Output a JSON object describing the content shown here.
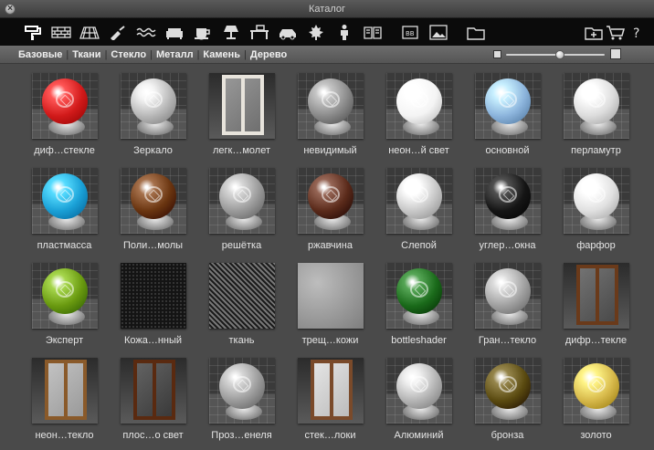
{
  "window": {
    "title": "Каталог"
  },
  "toolbar": {
    "icons": [
      "paint-icon",
      "brick-icon",
      "tiles-icon",
      "trowel-icon",
      "water-icon",
      "sofa-icon",
      "cup-icon",
      "lamp-icon",
      "desk-icon",
      "car-icon",
      "leaf-icon",
      "person-icon",
      "book-icon",
      "bsdf-icon",
      "image-icon",
      "folder-icon"
    ],
    "right_icons": [
      "new-folder-icon",
      "cart-icon",
      "help-icon"
    ]
  },
  "categories": [
    "Базовые",
    "Ткани",
    "Стекло",
    "Металл",
    "Камень",
    "Дерево"
  ],
  "zoom": {
    "value": 0.55
  },
  "materials": [
    [
      {
        "label": "диф…стекле",
        "kind": "sphere",
        "color": "#d11a1a"
      },
      {
        "label": "Зеркало",
        "kind": "sphere",
        "color": "#b8b8b8"
      },
      {
        "label": "легк…молет",
        "kind": "window",
        "frame": "#e8e4dc",
        "glass": "#6f6f6f"
      },
      {
        "label": "невидимый",
        "kind": "sphere",
        "color": "#8a8a8a"
      },
      {
        "label": "неон…й свет",
        "kind": "sphere",
        "color": "#f4f4f4"
      },
      {
        "label": "основной",
        "kind": "sphere",
        "color": "#8cb4dc"
      },
      {
        "label": "перламутр",
        "kind": "sphere",
        "color": "#dcdcdc"
      }
    ],
    [
      {
        "label": "пластмасса",
        "kind": "sphere",
        "color": "#1aa0d6"
      },
      {
        "label": "Поли…молы",
        "kind": "sphere",
        "color": "#6a3510"
      },
      {
        "label": "решётка",
        "kind": "sphere",
        "color": "#9a9a9a"
      },
      {
        "label": "ржавчина",
        "kind": "sphere",
        "color": "#5a2a1a"
      },
      {
        "label": "Слепой",
        "kind": "sphere",
        "color": "#c8c8c8"
      },
      {
        "label": "углер…окна",
        "kind": "sphere",
        "color": "#151515"
      },
      {
        "label": "фарфор",
        "kind": "sphere",
        "color": "#e0e0e0"
      }
    ],
    [
      {
        "label": "Эксперт",
        "kind": "sphere",
        "color": "#6a9a10"
      },
      {
        "label": "Кожа…нный",
        "kind": "texture",
        "texture": "leather"
      },
      {
        "label": "ткань",
        "kind": "texture",
        "texture": "fabric"
      },
      {
        "label": "трещ…кожи",
        "kind": "texture",
        "texture": "crackle"
      },
      {
        "label": "bottleshader",
        "kind": "sphere",
        "color": "#1a6a1a"
      },
      {
        "label": "Гран…текло",
        "kind": "sphere",
        "color": "#a0a0a0"
      },
      {
        "label": "дифр…текле",
        "kind": "window",
        "frame": "#6a3a1a",
        "glass": "#4a4a4a"
      }
    ],
    [
      {
        "label": "неон…текло",
        "kind": "window",
        "frame": "#8a5a2a",
        "glass": "#9a9a9a"
      },
      {
        "label": "плос…о свет",
        "kind": "window",
        "frame": "#5a2a10",
        "glass": "#3a3a3a"
      },
      {
        "label": "Проз…енеля",
        "kind": "sphere",
        "color": "#9a9a9a"
      },
      {
        "label": "стек…локи",
        "kind": "window",
        "frame": "#7a4a2a",
        "glass": "#bcbcbc"
      },
      {
        "label": "Алюминий",
        "kind": "sphere",
        "color": "#b4b4b4"
      },
      {
        "label": "бронза",
        "kind": "sphere",
        "color": "#5a4a10"
      },
      {
        "label": "золото",
        "kind": "sphere",
        "color": "#d6b84a"
      }
    ]
  ]
}
